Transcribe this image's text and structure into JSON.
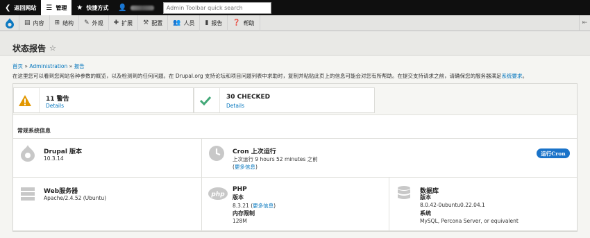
{
  "toolbar": {
    "back_label": "返回网站",
    "manage_label": "管理",
    "shortcuts_label": "快捷方式",
    "search_placeholder": "Admin Toolbar quick search"
  },
  "menu": {
    "items": [
      {
        "label": "内容",
        "icon": "file-icon"
      },
      {
        "label": "结构",
        "icon": "sitemap-icon"
      },
      {
        "label": "外观",
        "icon": "brush-icon"
      },
      {
        "label": "扩展",
        "icon": "puzzle-icon"
      },
      {
        "label": "配置",
        "icon": "wrench-icon"
      },
      {
        "label": "人员",
        "icon": "people-icon"
      },
      {
        "label": "报告",
        "icon": "bar-chart-icon"
      },
      {
        "label": "帮助",
        "icon": "help-icon"
      }
    ]
  },
  "page": {
    "title": "状态报告",
    "breadcrumb": {
      "home": "首页",
      "admin": "Administration",
      "reports": "报告",
      "sep": "»"
    },
    "intro_text": "在这里您可以看到您网站各种参数的概览，以及检测到的任何问题。在 Drupal.org 支持论坛和项目问题列表中求助时，复制并粘贴此页上的信息可能会对您有所帮助。在提交支持请求之前，请确保您的服务器满足",
    "intro_link": "系统要求",
    "intro_end": "。"
  },
  "counters": [
    {
      "title": "11 警告",
      "link": "Details",
      "kind": "warning",
      "color": "#e29700"
    },
    {
      "title": "30 CHECKED",
      "link": "Details",
      "kind": "checked",
      "color": "#42a877"
    }
  ],
  "general": {
    "section_title": "常规系统信息",
    "drupal": {
      "title": "Drupal 版本",
      "value": "10.3.14"
    },
    "cron": {
      "title": "Cron 上次运行",
      "value": "上次运行 9 hours 52 minutes 之前",
      "more": "更多信息",
      "button": "运行Cron"
    },
    "web": {
      "title": "Web服务器",
      "value": "Apache/2.4.52 (Ubuntu)"
    },
    "php": {
      "title": "PHP",
      "version_label": "版本",
      "version": "8.3.21",
      "more": "更多信息",
      "memory_label": "内存限制",
      "memory": "128M"
    },
    "db": {
      "title": "数据库",
      "version_label": "版本",
      "version": "8.0.42-0ubuntu0.22.04.1",
      "system_label": "系统",
      "system": "MySQL, Percona Server, or equivalent"
    }
  }
}
